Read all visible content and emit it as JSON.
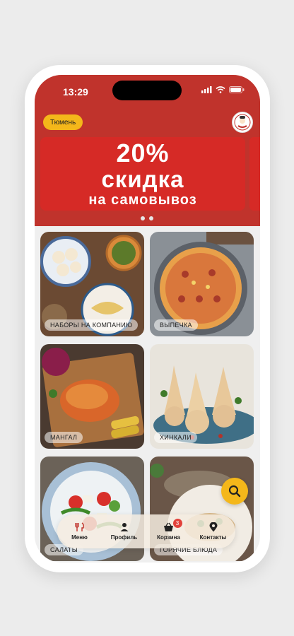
{
  "status_bar": {
    "time": "13:29"
  },
  "header": {
    "city_button": "Тюмень"
  },
  "banner": {
    "line1": "20%",
    "line2": "скидка",
    "line3": "на самовывоз",
    "dots_total": 3,
    "dots_active": 1
  },
  "colors": {
    "brand_red": "#c0332c",
    "accent_yellow": "#f4b71a"
  },
  "categories": [
    {
      "label": "НАБОРЫ НА КОМПАНИЮ"
    },
    {
      "label": "ВЫПЕЧКА"
    },
    {
      "label": "МАНГАЛ"
    },
    {
      "label": "ХИНКАЛИ"
    },
    {
      "label": "САЛАТЫ"
    },
    {
      "label": "ГОРЯЧИЕ БЛЮДА"
    }
  ],
  "bottom_nav": {
    "items": [
      {
        "label": "Меню",
        "icon": "fork-knife-icon"
      },
      {
        "label": "Профиль",
        "icon": "person-icon"
      },
      {
        "label": "Корзина",
        "icon": "basket-icon",
        "badge": "3"
      },
      {
        "label": "Контакты",
        "icon": "location-pin-icon"
      }
    ]
  },
  "search": {
    "icon": "search-icon"
  }
}
